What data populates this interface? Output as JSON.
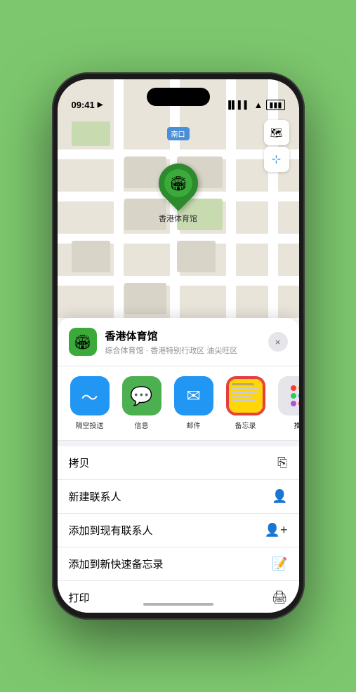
{
  "status": {
    "time": "09:41",
    "location_arrow": "▶"
  },
  "map": {
    "label": "南口",
    "map_icon": "🗺",
    "location_icon": "↗"
  },
  "place": {
    "name": "香港体育馆",
    "description": "综合体育馆 · 香港特别行政区 油尖旺区",
    "icon": "🏟",
    "close_label": "×"
  },
  "share_items": [
    {
      "id": "airdrop",
      "label": "隔空投送",
      "type": "airdrop"
    },
    {
      "id": "messages",
      "label": "信息",
      "type": "messages"
    },
    {
      "id": "mail",
      "label": "邮件",
      "type": "mail"
    },
    {
      "id": "notes",
      "label": "备忘录",
      "type": "notes"
    },
    {
      "id": "more",
      "label": "推",
      "type": "more"
    }
  ],
  "actions": [
    {
      "id": "copy",
      "label": "拷贝",
      "icon": "copy"
    },
    {
      "id": "new-contact",
      "label": "新建联系人",
      "icon": "person-add"
    },
    {
      "id": "add-existing",
      "label": "添加到现有联系人",
      "icon": "person-plus"
    },
    {
      "id": "add-notes",
      "label": "添加到新快速备忘录",
      "icon": "note"
    },
    {
      "id": "print",
      "label": "打印",
      "icon": "printer"
    }
  ],
  "side_dots": {
    "colors": [
      "#ff3b30",
      "#ff9500",
      "#34c759",
      "#007aff",
      "#af52de",
      "#ff2d55"
    ]
  }
}
